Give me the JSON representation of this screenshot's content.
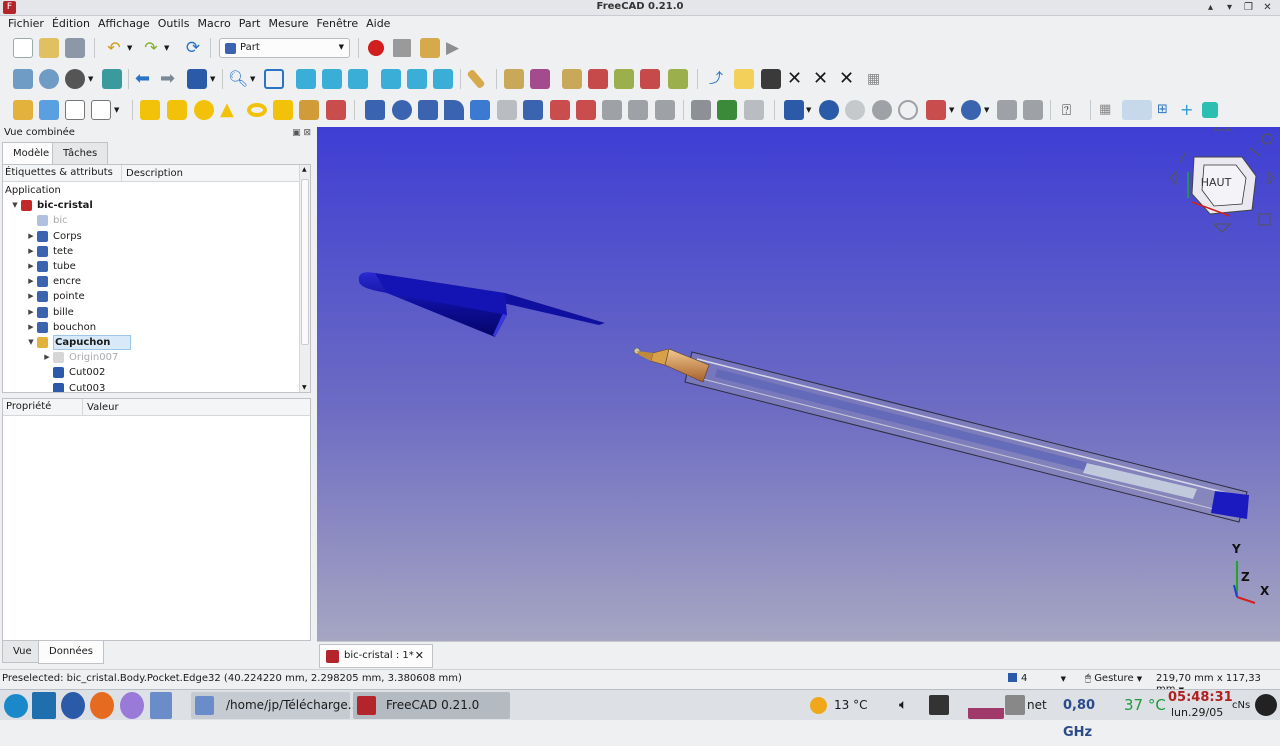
{
  "window": {
    "title": "FreeCAD 0.21.0"
  },
  "menu": [
    "Fichier",
    "Édition",
    "Affichage",
    "Outils",
    "Macro",
    "Part",
    "Mesure",
    "Fenêtre",
    "Aide"
  ],
  "workbench": {
    "selected": "Part"
  },
  "combo_view": {
    "title": "Vue combinée",
    "tabs": [
      "Modèle",
      "Tâches"
    ],
    "tree_columns": [
      "Étiquettes & attributs",
      "Description"
    ],
    "tree": [
      {
        "label": "Application",
        "level": 0,
        "icon": "none",
        "twisty": "none",
        "style": "normal"
      },
      {
        "label": "bic-cristal",
        "level": 1,
        "icon": "document-icon",
        "twisty": "open",
        "style": "bold"
      },
      {
        "label": "bic",
        "level": 2,
        "icon": "body-icon",
        "twisty": "none",
        "style": "greyed"
      },
      {
        "label": "Corps",
        "level": 2,
        "icon": "body-icon",
        "twisty": "closed",
        "style": "normal"
      },
      {
        "label": "tete",
        "level": 2,
        "icon": "body-icon",
        "twisty": "closed",
        "style": "normal"
      },
      {
        "label": "tube",
        "level": 2,
        "icon": "body-icon",
        "twisty": "closed",
        "style": "normal"
      },
      {
        "label": "encre",
        "level": 2,
        "icon": "body-icon",
        "twisty": "closed",
        "style": "normal"
      },
      {
        "label": "pointe",
        "level": 2,
        "icon": "body-icon",
        "twisty": "closed",
        "style": "normal"
      },
      {
        "label": "bille",
        "level": 2,
        "icon": "body-icon",
        "twisty": "closed",
        "style": "normal"
      },
      {
        "label": "bouchon",
        "level": 2,
        "icon": "body-icon",
        "twisty": "closed",
        "style": "normal"
      },
      {
        "label": "Capuchon",
        "level": 2,
        "icon": "body-active-icon",
        "twisty": "open",
        "style": "selected"
      },
      {
        "label": "Origin007",
        "level": 3,
        "icon": "origin-icon",
        "twisty": "closed",
        "style": "greyed"
      },
      {
        "label": "Cut002",
        "level": 3,
        "icon": "cut-icon",
        "twisty": "none",
        "style": "normal"
      },
      {
        "label": "Cut003",
        "level": 3,
        "icon": "cut-icon",
        "twisty": "none",
        "style": "normal"
      }
    ],
    "prop_columns": [
      "Propriété",
      "Valeur"
    ],
    "bottom_tabs": [
      "Vue",
      "Données"
    ]
  },
  "navcube": {
    "face": "HAUT"
  },
  "axes": {
    "x": "X",
    "y": "Y",
    "z": "Z"
  },
  "document_tab": {
    "label": "bic-cristal : 1*"
  },
  "status": {
    "preselected": "Preselected: bic_cristal.Body.Pocket.Edge32 (40.224220 mm, 2.298205 mm, 3.380608 mm)",
    "count": "4",
    "nav_style": "Gesture",
    "dimensions": "219,70 mm x 117,33 mm"
  },
  "taskbar": {
    "tasks": [
      "/home/jp/Télécharge...",
      "FreeCAD 0.21.0"
    ],
    "weather": "13 °C",
    "net": "net",
    "cpu_freq": "0,80 GHz",
    "cpu_temp": "37 °C",
    "time": "05:48:31",
    "date": "lun.29/05",
    "cns": "cNs"
  },
  "colors": {
    "viewport_top": "#3e3ed4",
    "viewport_bottom": "#a6a6c2",
    "cap_blue": "#1616a8",
    "selection": "#d8eaf9",
    "record_red": "#d11f1f"
  }
}
